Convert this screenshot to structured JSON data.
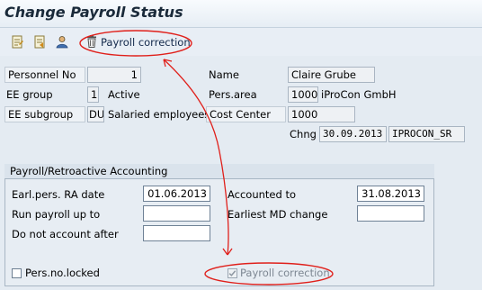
{
  "window": {
    "title": "Change Payroll Status"
  },
  "toolbar": {
    "icons": [
      "display-change-icon",
      "other-personnel-icon",
      "person-icon"
    ],
    "payroll_correction_label": "Payroll correction"
  },
  "header": {
    "personnel_no_label": "Personnel No",
    "personnel_no_value": "1",
    "name_label": "Name",
    "name_value": "Claire Grube",
    "ee_group_label": "EE group",
    "ee_group_code": "1",
    "ee_group_text": "Active",
    "pers_area_label": "Pers.area",
    "pers_area_code": "1000",
    "pers_area_text": "iProCon GmbH",
    "ee_subgroup_label": "EE subgroup",
    "ee_subgroup_code": "DU",
    "ee_subgroup_text": "Salaried employees",
    "cost_center_label": "Cost Center",
    "cost_center_value": "1000",
    "chng_label": "Chng",
    "chng_date": "30.09.2013",
    "chng_user": "IPROCON_SR"
  },
  "payroll_group": {
    "title": "Payroll/Retroactive Accounting",
    "earliest_ra_label": "Earl.pers. RA date",
    "earliest_ra_value": "01.06.2013",
    "accounted_to_label": "Accounted to",
    "accounted_to_value": "31.08.2013",
    "run_payroll_label": "Run payroll up to",
    "run_payroll_value": "",
    "earliest_md_label": "Earliest MD change",
    "earliest_md_value": "",
    "do_not_account_label": "Do not account after",
    "do_not_account_value": "",
    "pers_locked_label": "Pers.no.locked",
    "pers_locked_checked": false,
    "payroll_correction_label": "Payroll correction",
    "payroll_correction_checked": true
  },
  "colors": {
    "annotation": "#e0201b",
    "background": "#e4ebf2"
  }
}
